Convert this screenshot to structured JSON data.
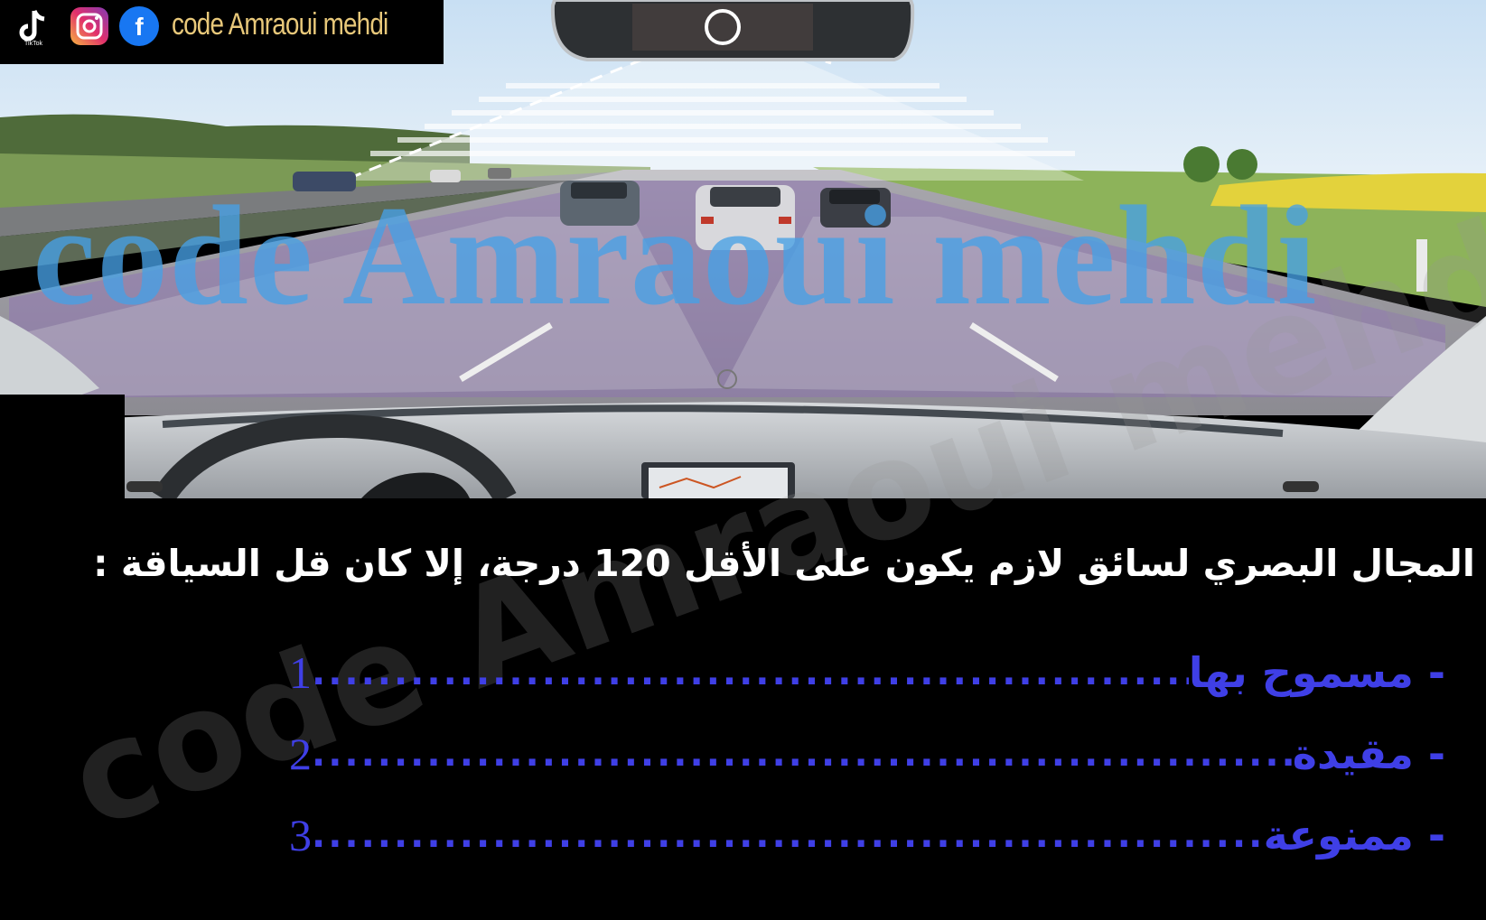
{
  "branding": {
    "icons": [
      "tiktok-icon",
      "instagram-icon",
      "facebook-icon"
    ],
    "tiktok_label": "TikTok",
    "facebook_glyph": "f",
    "channel_name": "code Amraoui mehdi",
    "watermark": "code Amraoui mehdi"
  },
  "question": {
    "text": "المجال البصري لسائق لازم يكون على الأقل 120 درجة، إلا كان قل السياقة :",
    "options": [
      {
        "number": "1",
        "label": "- مسموح بها"
      },
      {
        "number": "2",
        "label": "- مقيدة"
      },
      {
        "number": "3",
        "label": "- ممنوعة"
      }
    ]
  },
  "colors": {
    "option_blue": "#3f3fe6",
    "watermark_blue": "#46a0e6",
    "channel_gold": "#e8c87a",
    "background": "#000000"
  }
}
